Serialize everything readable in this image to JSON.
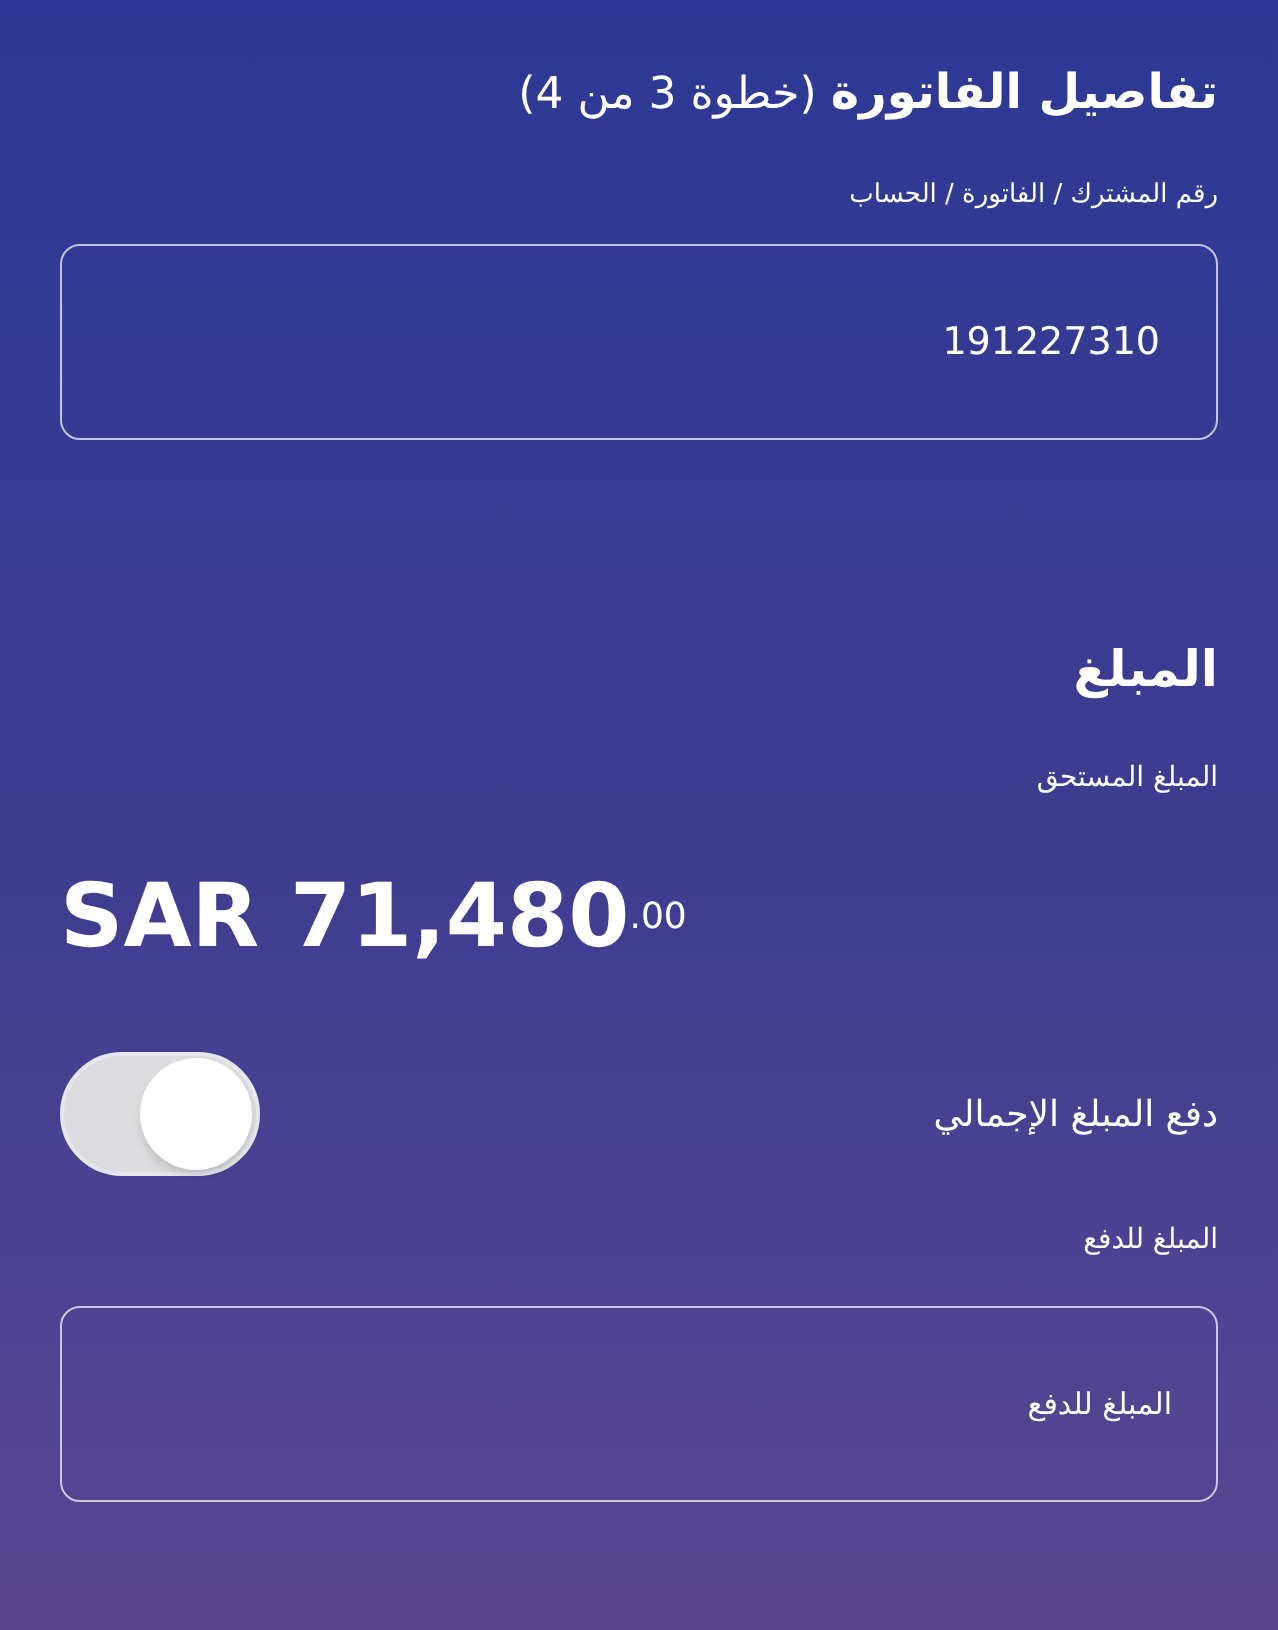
{
  "title": "**تفاصيل الفاتورة** (خطوة 3 من 4)",
  "account_field": {
    "label": "رقم المشترك / الفاتورة / الحساب",
    "value": "191227310"
  },
  "amount_section": {
    "heading": "المبلغ",
    "due_label": "المبلغ المستحق",
    "due_amount": "SAR 71,480$^{.00}$"
  },
  "pay_full_toggle": {
    "label": "دفع المبلغ الإجمالي",
    "on": false
  },
  "pay_field": {
    "label": "المبلغ للدفع",
    "placeholder": "المبلغ للدفع"
  }
}
